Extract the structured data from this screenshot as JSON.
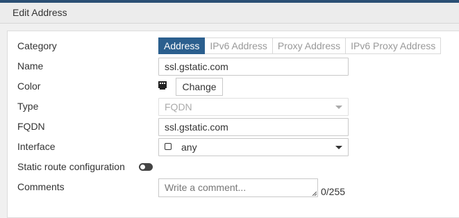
{
  "header": {
    "title": "Edit Address"
  },
  "labels": {
    "category": "Category",
    "name": "Name",
    "color": "Color",
    "type": "Type",
    "fqdn": "FQDN",
    "interface": "Interface",
    "static_route": "Static route configuration",
    "comments": "Comments"
  },
  "category_tabs": [
    {
      "label": "Address",
      "active": true
    },
    {
      "label": "IPv6 Address",
      "active": false
    },
    {
      "label": "Proxy Address",
      "active": false
    },
    {
      "label": "IPv6 Proxy Address",
      "active": false
    }
  ],
  "fields": {
    "name_value": "ssl.gstatic.com",
    "color_button": "Change",
    "type_value": "FQDN",
    "fqdn_value": "ssl.gstatic.com",
    "interface_value": "any",
    "static_route_enabled": false,
    "comments_placeholder": "Write a comment...",
    "comments_count": "0/255"
  },
  "colors": {
    "accent": "#2b5f8e",
    "topbar": "#2b4f74"
  }
}
